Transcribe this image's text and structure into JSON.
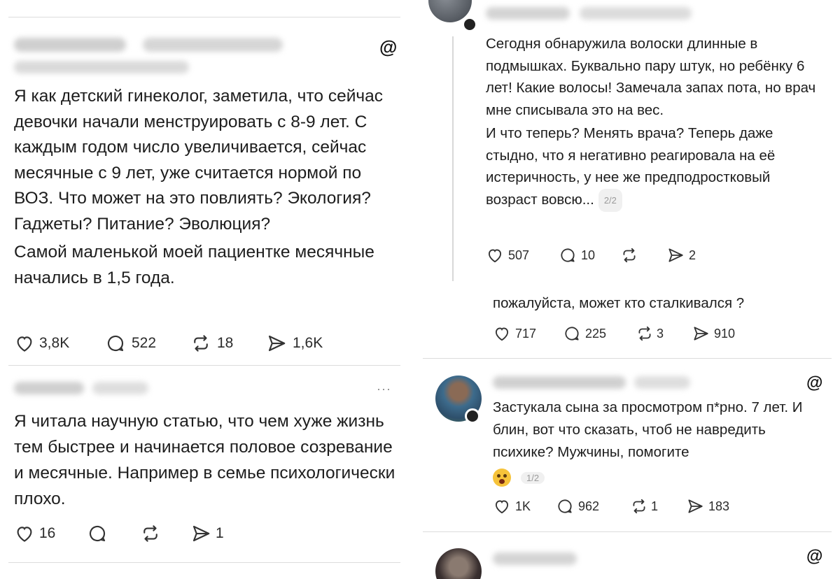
{
  "post1": {
    "text_p1": "Я как детский гинеколог, заметила, что сейчас девочки начали менструировать с 8-9 лет. С каждым годом число увеличивается, сейчас месячные с 9 лет, уже считается нормой по ВОЗ. Что может на это повлиять? Экология? Гаджеты? Питание? Эволюция?",
    "text_p2": "Самой маленькой моей пациентке месячные начались в 1,5 года.",
    "likes": "3,8K",
    "replies": "522",
    "reposts": "18",
    "shares": "1,6K"
  },
  "post2": {
    "more": "···",
    "text": "Я читала научную статью, что чем хуже жизнь тем быстрее и начинается половое созревание и месячные. Например в семье психологически плохо.",
    "likes": "16",
    "replies": "",
    "reposts": "",
    "shares": "1"
  },
  "post3": {
    "text_p1": "Сегодня обнаружила волоски длинные в подмышках. Буквально пару штук, но ребёнку 6 лет! Какие волосы! Замечала запах пота, но врач мне списывала это на вес.",
    "text_p2": "И что теперь? Менять врача? Теперь даже стыдно, что я негативно реагировала на её истеричность, у нее же предподростковый возраст вовсю...",
    "page": "2/2",
    "likes": "507",
    "replies": "10",
    "reposts": "",
    "shares": "2"
  },
  "post4": {
    "text": "пожалуйста, может кто сталкивался ?",
    "likes": "717",
    "replies": "225",
    "reposts": "3",
    "shares": "910"
  },
  "post5": {
    "text": "Застукала сына за просмотром п*рно. 7 лет. И блин, вот что сказать,  чтоб не навредить психике? Мужчины, помогите",
    "page": "1/2",
    "likes": "1K",
    "replies": "962",
    "reposts": "1",
    "shares": "183"
  },
  "threads_logo": "@"
}
